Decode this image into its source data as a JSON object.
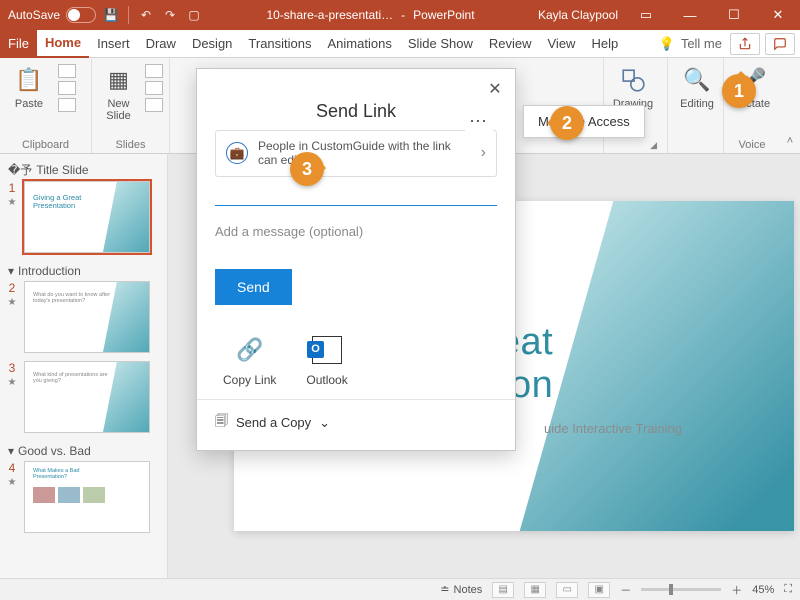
{
  "titlebar": {
    "autosave_label": "AutoSave",
    "filename": "10-share-a-presentati…",
    "app": "PowerPoint",
    "user": "Kayla Claypool"
  },
  "tabs": {
    "file": "File",
    "items": [
      "Home",
      "Insert",
      "Draw",
      "Design",
      "Transitions",
      "Animations",
      "Slide Show",
      "Review",
      "View",
      "Help"
    ],
    "active_index": 0,
    "tellme": "Tell me"
  },
  "ribbon": {
    "clipboard": {
      "label": "Clipboard",
      "paste": "Paste"
    },
    "slides": {
      "label": "Slides",
      "newslide": "New\nSlide"
    },
    "drawing": {
      "label": "Drawing",
      "btn": "Drawing"
    },
    "editing": {
      "label": "Editing",
      "btn": "Editing"
    },
    "voice": {
      "label": "Voice",
      "dictate": "Dictate"
    }
  },
  "outline": {
    "sections": [
      {
        "title": "Title Slide",
        "slides": [
          {
            "num": "1",
            "title": "Giving a Great Presentation",
            "active": true
          }
        ]
      },
      {
        "title": "Introduction",
        "slides": [
          {
            "num": "2",
            "body": "What do you want to know after today's presentation?"
          },
          {
            "num": "3",
            "body": "What kind of presentations are you giving?"
          }
        ]
      },
      {
        "title": "Good vs. Bad",
        "slides": [
          {
            "num": "4",
            "title2": "What Makes a Bad Presentation?"
          }
        ]
      }
    ]
  },
  "slide": {
    "title": "Giving a Great Presentation",
    "title_visible": "a Great\nentation",
    "subtitle_visible": "uide Interactive Training"
  },
  "share": {
    "heading": "Send Link",
    "manage": "Manage Access",
    "perm_text": "People in CustomGuide with the link can edit",
    "msg_placeholder": "Add a message (optional)",
    "send": "Send",
    "copy_link": "Copy Link",
    "outlook": "Outlook",
    "send_copy": "Send a Copy"
  },
  "status": {
    "notes": "Notes",
    "zoom": "45%"
  },
  "callouts": {
    "b1": "1",
    "b2": "2",
    "b3": "3"
  }
}
